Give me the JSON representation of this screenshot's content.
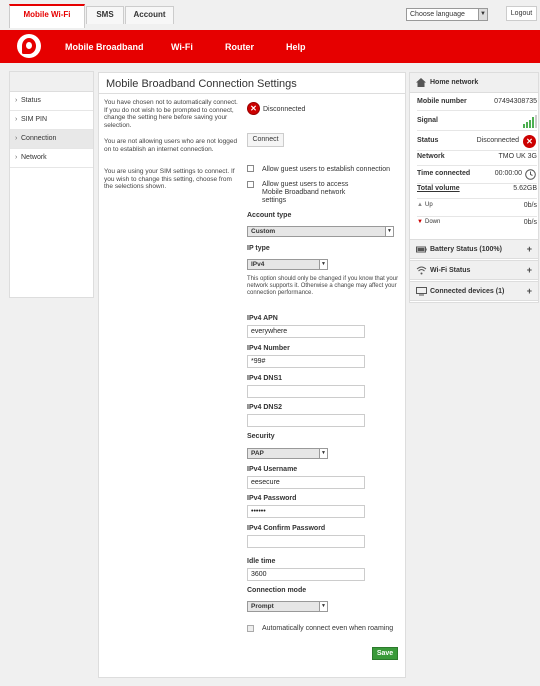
{
  "tabs": [
    "Mobile Wi-Fi",
    "SMS",
    "Account"
  ],
  "language": {
    "label": "Choose language"
  },
  "logout_label": "Logout",
  "nav": [
    "Mobile Broadband",
    "Wi-Fi",
    "Router",
    "Help"
  ],
  "sidebar": {
    "items": [
      {
        "label": "Status"
      },
      {
        "label": "SIM PIN"
      },
      {
        "label": "Connection"
      },
      {
        "label": "Network"
      }
    ]
  },
  "main": {
    "title": "Mobile Broadband Connection Settings",
    "info": [
      "You have chosen not to automatically connect. If you do not wish to be prompted to connect, change the setting here before saving your selection.",
      "You are not allowing users who are not logged on to establish an internet connection.",
      "You are using your SIM settings to connect. If you wish to change this setting, choose from the selections shown."
    ],
    "status": "Disconnected",
    "connect_label": "Connect",
    "guest_allow": "Allow guest users to establish connection",
    "guest_access": "Allow guest users to access Mobile Broadband network settings",
    "account_type_label": "Account type",
    "account_type": "Custom",
    "ip_type_label": "IP type",
    "ip_type": "IPv4",
    "note": "This option should only be changed if you know that your network supports it. Otherwise a change may affect your connection performance.",
    "apn_label": "IPv4 APN",
    "apn": "everywhere",
    "number_label": "IPv4 Number",
    "number": "*99#",
    "dns1_label": "IPv4 DNS1",
    "dns2_label": "IPv4 DNS2",
    "security_label": "Security",
    "security": "PAP",
    "username_label": "IPv4 Username",
    "username": "eesecure",
    "password_label": "IPv4 Password",
    "password": "••••••",
    "confirm_label": "IPv4 Confirm Password",
    "idle_label": "Idle time",
    "idle": "3600",
    "mode_label": "Connection mode",
    "mode": "Prompt",
    "roaming": "Automatically connect even when roaming",
    "save_label": "Save"
  },
  "home": {
    "title": "Home network",
    "mobile_number_label": "Mobile number",
    "mobile_number": "07494308735",
    "signal_label": "Signal",
    "status_label": "Status",
    "status": "Disconnected",
    "network_label": "Network",
    "network": "TMO UK 3G",
    "time_label": "Time connected",
    "time": "00:00:00",
    "volume_label": "Total volume",
    "volume": "5.62GB",
    "up_label": "Up",
    "up": "0b/s",
    "down_label": "Down",
    "down": "0b/s"
  },
  "sections": [
    "Battery Status (100%)",
    "Wi-Fi Status",
    "Connected devices (1)"
  ],
  "plus": "+"
}
